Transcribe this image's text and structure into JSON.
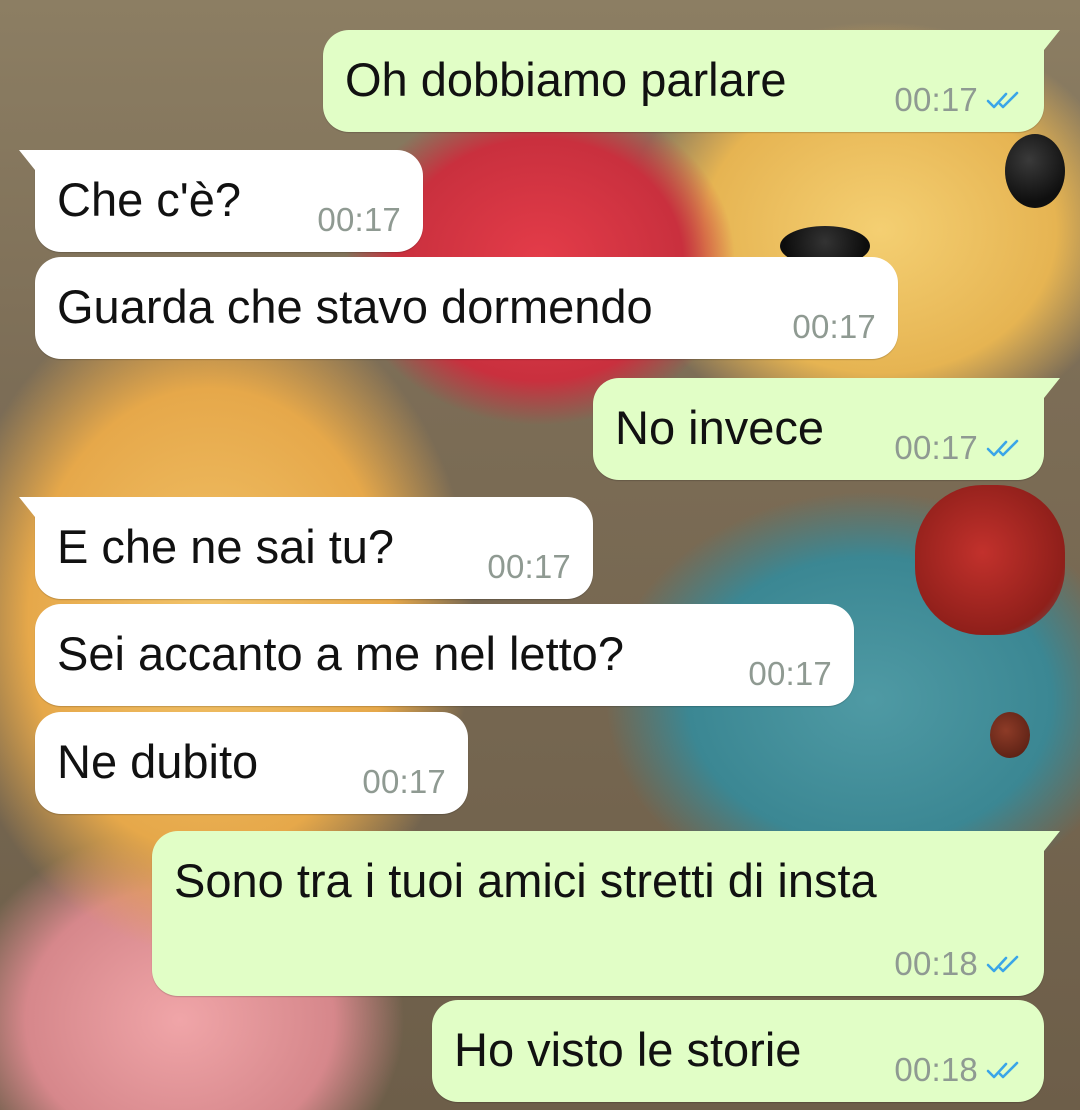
{
  "conversation": {
    "messages": [
      {
        "direction": "outgoing",
        "text": "Oh dobbiamo parlare",
        "time": "00:17",
        "status": "read"
      },
      {
        "direction": "incoming",
        "text": "Che c'è?",
        "time": "00:17"
      },
      {
        "direction": "incoming",
        "text": "Guarda che stavo dormendo",
        "time": "00:17"
      },
      {
        "direction": "outgoing",
        "text": "No invece",
        "time": "00:17",
        "status": "read"
      },
      {
        "direction": "incoming",
        "text": "E che ne sai tu?",
        "time": "00:17"
      },
      {
        "direction": "incoming",
        "text": "Sei accanto a me nel letto?",
        "time": "00:17"
      },
      {
        "direction": "incoming",
        "text": "Ne dubito",
        "time": "00:17"
      },
      {
        "direction": "outgoing",
        "text": "Sono tra i tuoi amici stretti di insta",
        "time": "00:18",
        "status": "read"
      },
      {
        "direction": "outgoing",
        "text": "Ho visto le storie",
        "time": "00:18",
        "status": "read"
      }
    ]
  },
  "colors": {
    "outgoing_bubble": "#e1fec6",
    "incoming_bubble": "#ffffff",
    "timestamp": "#8f9a92",
    "read_ticks": "#3aa5e8"
  },
  "icons": {
    "read_receipt": "double-check-icon"
  },
  "wallpaper": {
    "description_icon": "teddy-bear-wallpaper"
  }
}
